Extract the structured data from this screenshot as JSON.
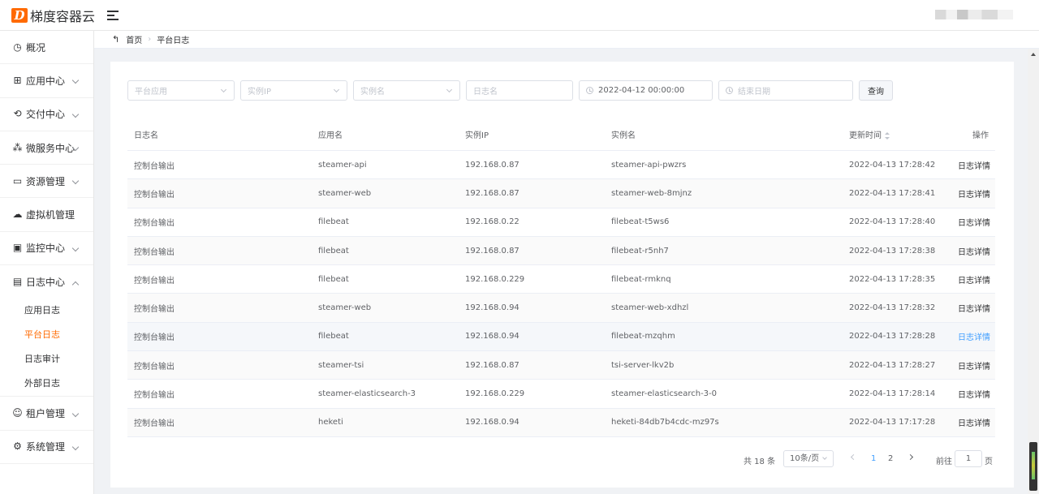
{
  "header": {
    "logo_mark": "D",
    "app_name": "梯度容器云"
  },
  "sidebar": {
    "items": [
      {
        "label": "概况",
        "icon": "clock-pie-icon",
        "glyph": "◷"
      },
      {
        "label": "应用中心",
        "icon": "grid-icon",
        "glyph": "⊞"
      },
      {
        "label": "交付中心",
        "icon": "delivery-icon",
        "glyph": "⟲"
      },
      {
        "label": "微服务中心",
        "icon": "microservice-icon",
        "glyph": "⁂"
      },
      {
        "label": "资源管理",
        "icon": "folder-icon",
        "glyph": "▭"
      },
      {
        "label": "虚拟机管理",
        "icon": "cloud-icon",
        "glyph": "☁"
      },
      {
        "label": "监控中心",
        "icon": "monitor-icon",
        "glyph": "▣"
      },
      {
        "label": "日志中心",
        "icon": "log-icon",
        "glyph": "▤"
      }
    ],
    "log_submenu": [
      "应用日志",
      "平台日志",
      "日志审计",
      "外部日志"
    ],
    "bottom_items": [
      {
        "label": "租户管理",
        "icon": "tenant-icon",
        "glyph": "☺"
      },
      {
        "label": "系统管理",
        "icon": "gear-icon",
        "glyph": "⚙"
      }
    ]
  },
  "breadcrumb": {
    "back_glyph": "↰",
    "home": "首页",
    "current": "平台日志"
  },
  "filters": {
    "app_placeholder": "平台应用",
    "ip_placeholder": "实例IP",
    "instance_placeholder": "实例名",
    "logname_placeholder": "日志名",
    "start_date": "2022-04-12 00:00:00",
    "end_placeholder": "结束日期",
    "query_label": "查询"
  },
  "table": {
    "headers": [
      "日志名",
      "应用名",
      "实例IP",
      "实例名",
      "更新时间",
      "操作"
    ],
    "rows": [
      [
        "控制台输出",
        "steamer-api",
        "192.168.0.87",
        "steamer-api-pwzrs",
        "2022-04-13 17:28:42",
        "日志详情"
      ],
      [
        "控制台输出",
        "steamer-web",
        "192.168.0.87",
        "steamer-web-8mjnz",
        "2022-04-13 17:28:41",
        "日志详情"
      ],
      [
        "控制台输出",
        "filebeat",
        "192.168.0.22",
        "filebeat-t5ws6",
        "2022-04-13 17:28:40",
        "日志详情"
      ],
      [
        "控制台输出",
        "filebeat",
        "192.168.0.87",
        "filebeat-r5nh7",
        "2022-04-13 17:28:38",
        "日志详情"
      ],
      [
        "控制台输出",
        "filebeat",
        "192.168.0.229",
        "filebeat-rmknq",
        "2022-04-13 17:28:35",
        "日志详情"
      ],
      [
        "控制台输出",
        "steamer-web",
        "192.168.0.94",
        "steamer-web-xdhzl",
        "2022-04-13 17:28:32",
        "日志详情"
      ],
      [
        "控制台输出",
        "filebeat",
        "192.168.0.94",
        "filebeat-mzqhm",
        "2022-04-13 17:28:28",
        "日志详情"
      ],
      [
        "控制台输出",
        "steamer-tsi",
        "192.168.0.87",
        "tsi-server-lkv2b",
        "2022-04-13 17:28:27",
        "日志详情"
      ],
      [
        "控制台输出",
        "steamer-elasticsearch-3",
        "192.168.0.229",
        "steamer-elasticsearch-3-0",
        "2022-04-13 17:28:14",
        "日志详情"
      ],
      [
        "控制台输出",
        "heketi",
        "192.168.0.94",
        "heketi-84db7b4cdc-mz97s",
        "2022-04-13 17:17:28",
        "日志详情"
      ]
    ]
  },
  "pagination": {
    "total": "共 18 条",
    "page_size": "10条/页",
    "pages": [
      "1",
      "2"
    ],
    "goto_label": "前往",
    "goto_value": "1",
    "page_suffix": "页"
  },
  "colors": {
    "accent": "#ff6a00",
    "link": "#409eff"
  }
}
